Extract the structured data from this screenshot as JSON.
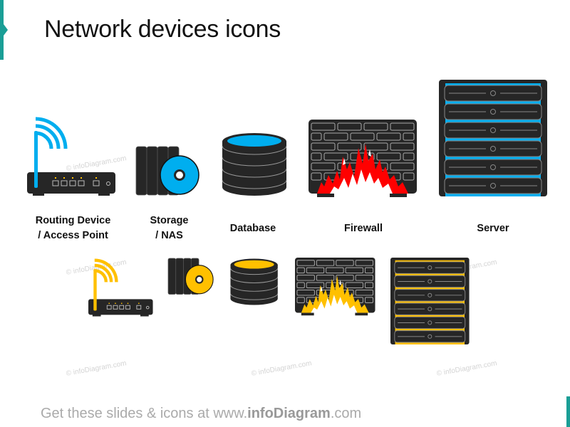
{
  "title": "Network devices icons",
  "colors": {
    "accent": "#1a9e96",
    "blue": "#00aeef",
    "yellow": "#ffc000",
    "red": "#ff0000",
    "dark": "#262626"
  },
  "devices": [
    {
      "label": "Routing Device\n/ Access Point",
      "icon": "router-icon"
    },
    {
      "label": "Storage\n/ NAS",
      "icon": "storage-icon"
    },
    {
      "label": "Database",
      "icon": "database-icon"
    },
    {
      "label": "Firewall",
      "icon": "firewall-icon"
    },
    {
      "label": "Server",
      "icon": "server-icon"
    }
  ],
  "watermark": "© infoDiagram.com",
  "footer": {
    "prefix": "Get these slides & icons at www.",
    "brand": "infoDiagram",
    "suffix": ".com"
  }
}
